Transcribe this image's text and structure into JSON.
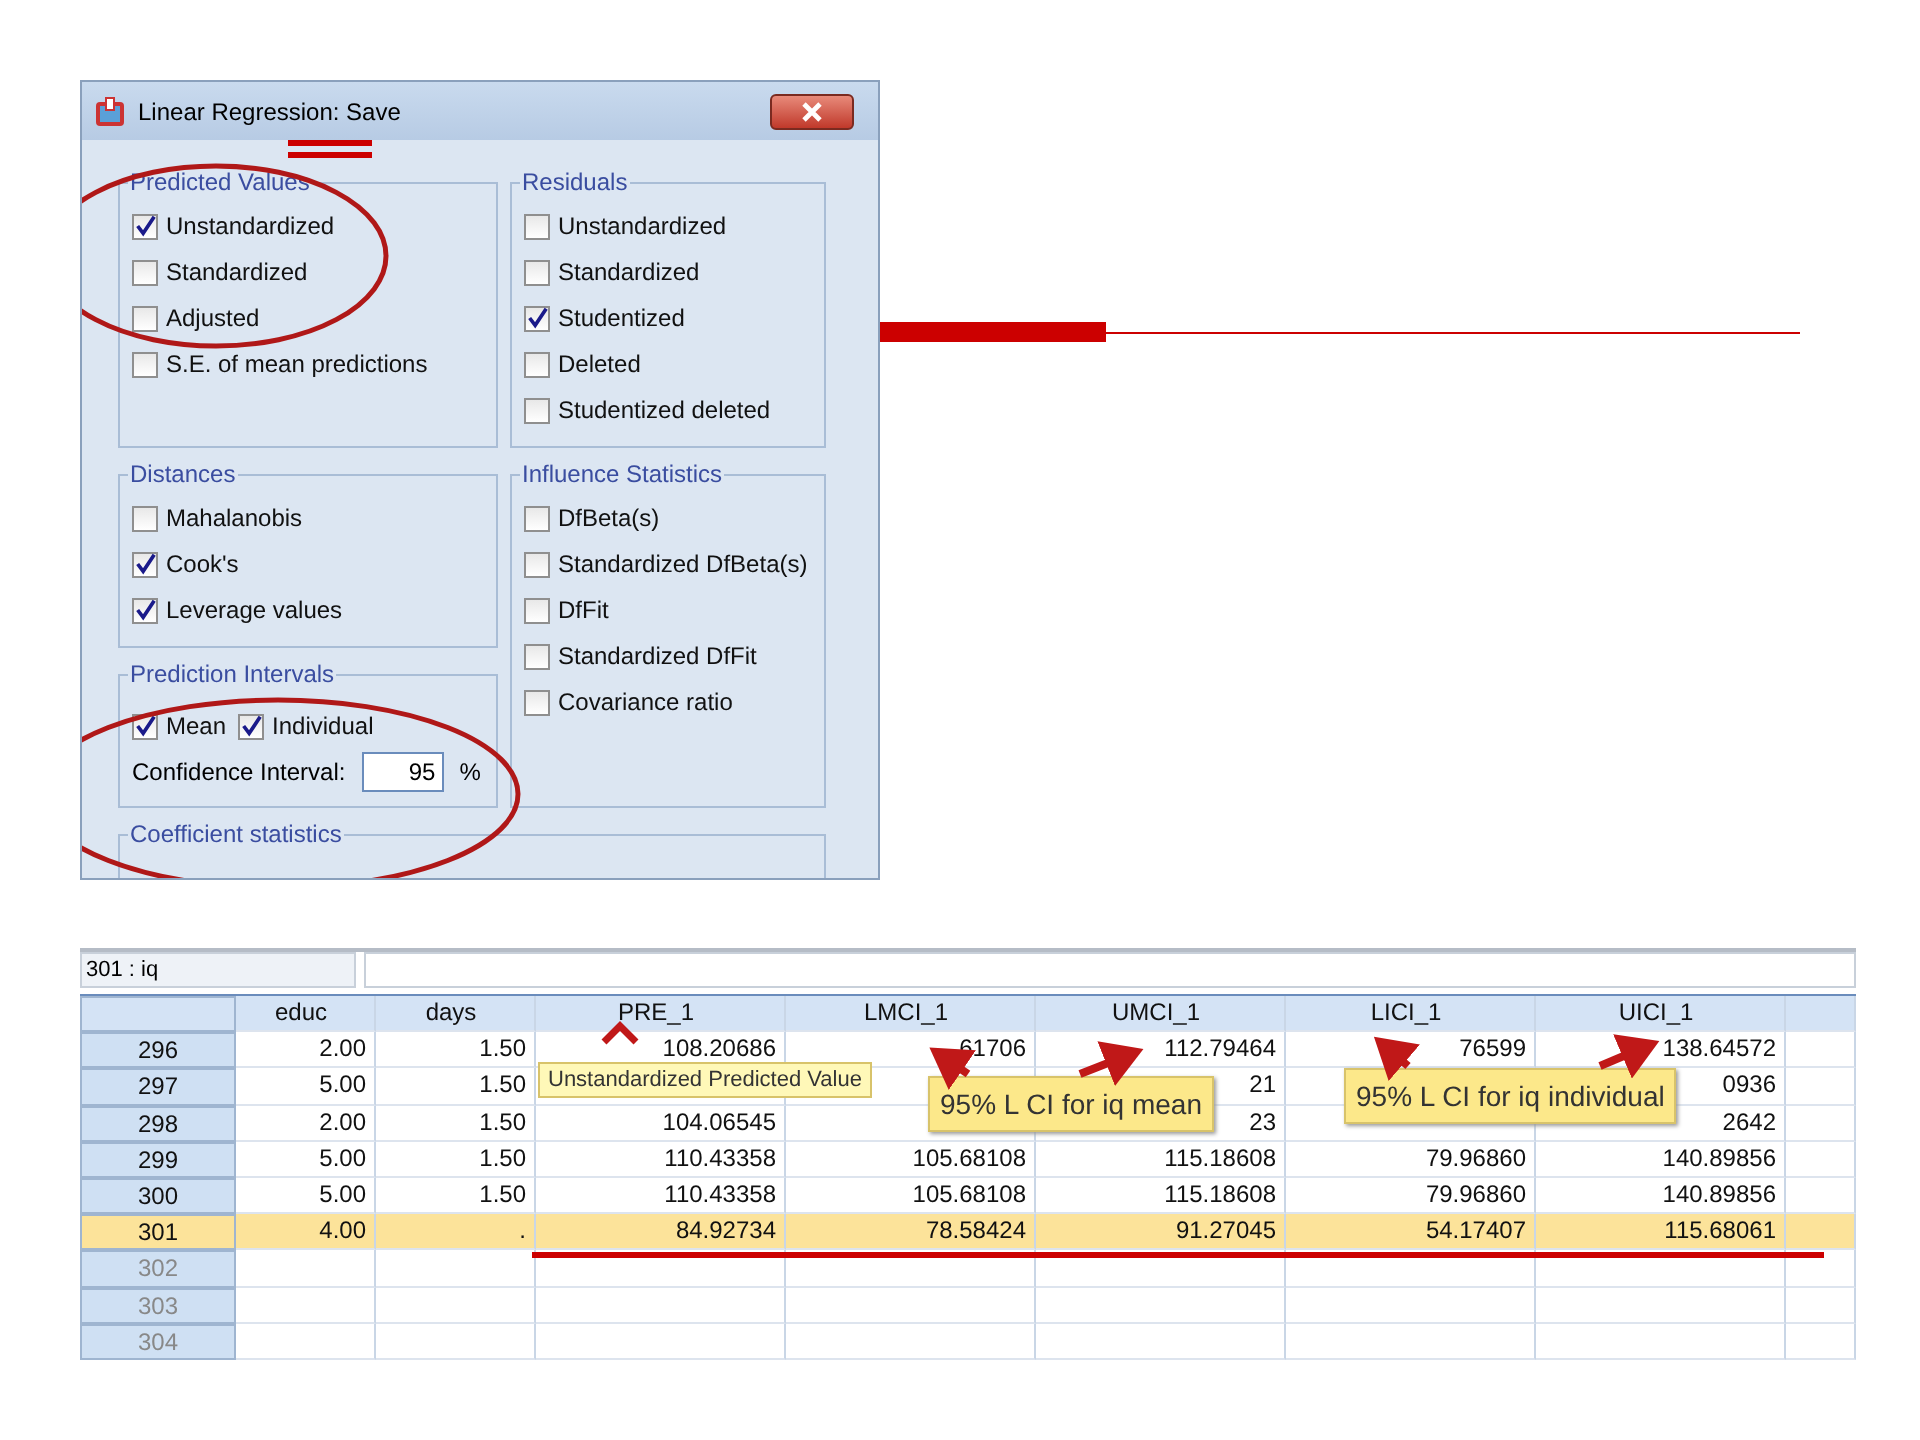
{
  "dialog": {
    "title": "Linear Regression: Save",
    "left_groups": [
      {
        "title": "Predicted Values",
        "kind": "list",
        "items": [
          {
            "label": "Unstandardized",
            "checked": true
          },
          {
            "label": "Standardized",
            "checked": false
          },
          {
            "label": "Adjusted",
            "checked": false
          },
          {
            "label": "S.E. of mean predictions",
            "checked": false
          }
        ]
      },
      {
        "title": "Distances",
        "kind": "list",
        "items": [
          {
            "label": "Mahalanobis",
            "checked": false
          },
          {
            "label": "Cook's",
            "checked": true
          },
          {
            "label": "Leverage values",
            "checked": true
          }
        ]
      },
      {
        "title": "Prediction Intervals",
        "kind": "interval",
        "items": [
          {
            "label": "Mean",
            "checked": true
          },
          {
            "label": "Individual",
            "checked": true
          }
        ],
        "confidence": {
          "label": "Confidence Interval:",
          "value": "95",
          "unit": "%"
        }
      }
    ],
    "right_groups": [
      {
        "title": "Residuals",
        "items": [
          {
            "label": "Unstandardized",
            "checked": false
          },
          {
            "label": "Standardized",
            "checked": false
          },
          {
            "label": "Studentized",
            "checked": true
          },
          {
            "label": "Deleted",
            "checked": false
          },
          {
            "label": "Studentized deleted",
            "checked": false
          }
        ]
      },
      {
        "title": "Influence Statistics",
        "items": [
          {
            "label": "DfBeta(s)",
            "checked": false
          },
          {
            "label": "Standardized DfBeta(s)",
            "checked": false
          },
          {
            "label": "DfFit",
            "checked": false
          },
          {
            "label": "Standardized DfFit",
            "checked": false
          },
          {
            "label": "Covariance ratio",
            "checked": false
          }
        ]
      }
    ],
    "footer_group": {
      "title": "Coefficient statistics"
    }
  },
  "data_view": {
    "cell_ref": "301 : iq",
    "columns": [
      "educ",
      "days",
      "PRE_1",
      "LMCI_1",
      "UMCI_1",
      "LICI_1",
      "UICI_1"
    ],
    "rows": [
      {
        "number": "296",
        "kind": "data",
        "selected": false,
        "cells": [
          "2.00",
          "1.50",
          "108.20686",
          "61706",
          "112.79464",
          "76599",
          "138.64572"
        ]
      },
      {
        "number": "297",
        "kind": "data",
        "selected": false,
        "cells": [
          "5.00",
          "1.50",
          null,
          null,
          "21",
          null,
          "0936"
        ]
      },
      {
        "number": "298",
        "kind": "data",
        "selected": false,
        "cells": [
          "2.00",
          "1.50",
          "104.06545",
          null,
          "23",
          null,
          "2642"
        ]
      },
      {
        "number": "299",
        "kind": "data",
        "selected": false,
        "cells": [
          "5.00",
          "1.50",
          "110.43358",
          "105.68108",
          "115.18608",
          "79.96860",
          "140.89856"
        ]
      },
      {
        "number": "300",
        "kind": "data",
        "selected": false,
        "cells": [
          "5.00",
          "1.50",
          "110.43358",
          "105.68108",
          "115.18608",
          "79.96860",
          "140.89856"
        ]
      },
      {
        "number": "301",
        "kind": "data",
        "selected": true,
        "cells": [
          "4.00",
          ".",
          "84.92734",
          "78.58424",
          "91.27045",
          "54.17407",
          "115.68061"
        ]
      },
      {
        "number": "302",
        "kind": "blank",
        "selected": false
      },
      {
        "number": "303",
        "kind": "blank",
        "selected": false
      },
      {
        "number": "304",
        "kind": "blank",
        "selected": false
      }
    ]
  },
  "callouts": [
    {
      "text": "Unstandardized Predicted Value",
      "kind": "tooltip"
    },
    {
      "text": "95% L CI for iq mean",
      "kind": "note"
    },
    {
      "text": "95% L CI for iq individual",
      "kind": "note"
    }
  ]
}
